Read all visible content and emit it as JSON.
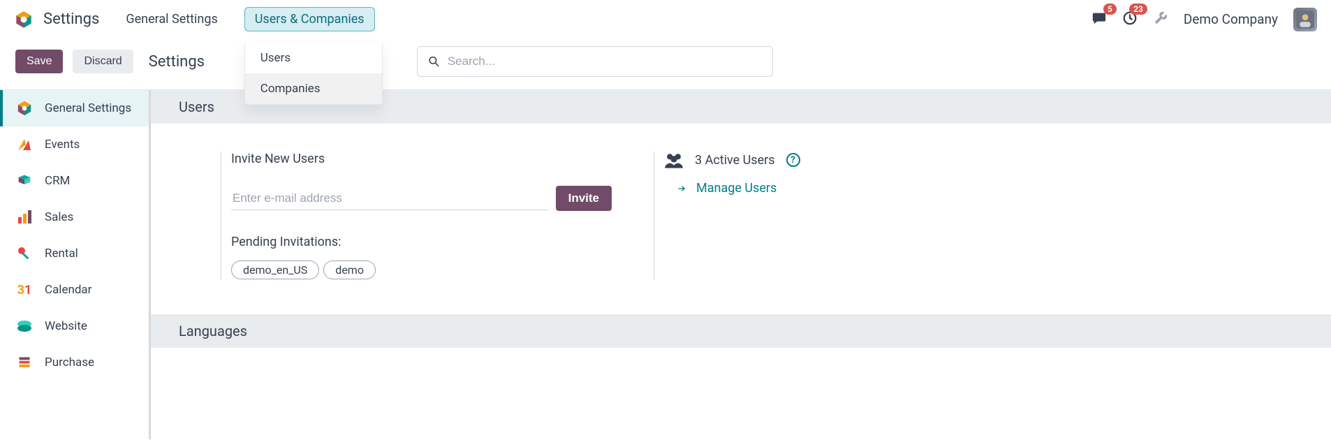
{
  "header": {
    "app_title": "Settings",
    "menu": {
      "general": "General Settings",
      "users_companies": "Users & Companies"
    },
    "dropdown": {
      "users": "Users",
      "companies": "Companies"
    },
    "badges": {
      "messages": "5",
      "activities": "23"
    },
    "company": "Demo Company"
  },
  "actions": {
    "save": "Save",
    "discard": "Discard",
    "page_title": "Settings",
    "search_placeholder": "Search..."
  },
  "sidebar": {
    "items": [
      {
        "label": "General Settings"
      },
      {
        "label": "Events"
      },
      {
        "label": "CRM"
      },
      {
        "label": "Sales"
      },
      {
        "label": "Rental"
      },
      {
        "label": "Calendar"
      },
      {
        "label": "Website"
      },
      {
        "label": "Purchase"
      }
    ]
  },
  "sections": {
    "users_title": "Users",
    "invite_title": "Invite New Users",
    "email_placeholder": "Enter e-mail address",
    "invite_btn": "Invite",
    "pending_label": "Pending Invitations:",
    "pending": [
      "demo_en_US",
      "demo"
    ],
    "active_users": "3 Active Users",
    "manage_users": "Manage Users",
    "languages_title": "Languages"
  }
}
